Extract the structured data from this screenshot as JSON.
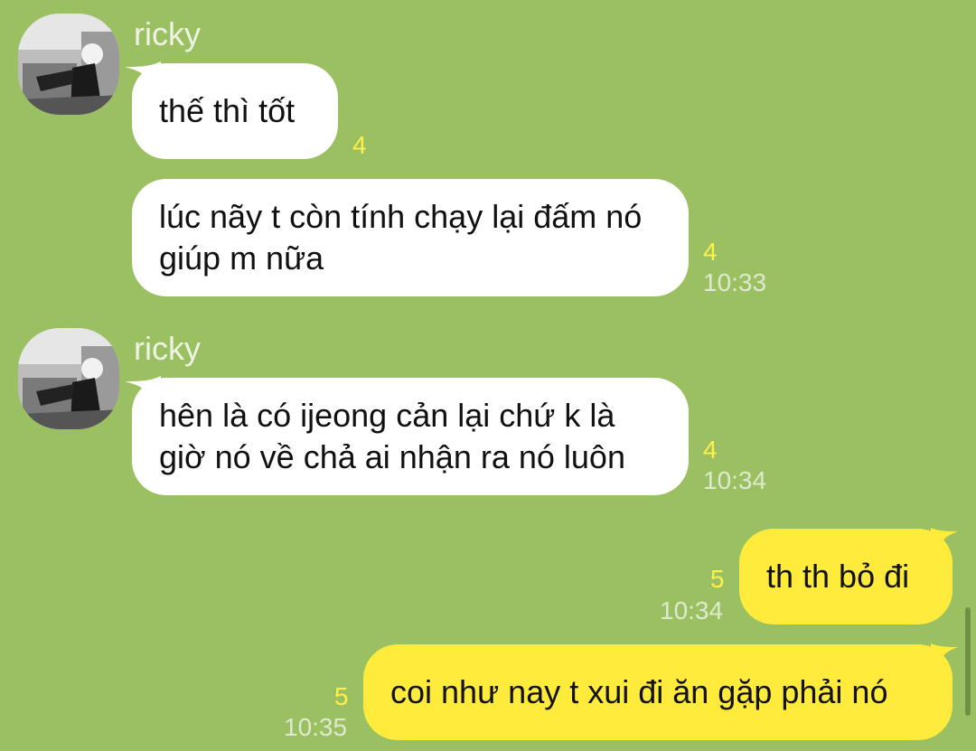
{
  "messages": [
    {
      "id": "m1",
      "direction": "incoming",
      "sender": "ricky",
      "text": "thế thì tốt",
      "read_count": "4",
      "time": ""
    },
    {
      "id": "m2",
      "direction": "incoming",
      "sender": "",
      "text": "lúc nãy t còn tính chạy lại đấm nó giúp m nữa",
      "read_count": "4",
      "time": "10:33"
    },
    {
      "id": "m3",
      "direction": "incoming",
      "sender": "ricky",
      "text": "hên là có ijeong cản lại chứ k là giờ nó về chả ai nhận ra nó luôn",
      "read_count": "4",
      "time": "10:34"
    },
    {
      "id": "m4",
      "direction": "outgoing",
      "sender": "",
      "text": "th th bỏ đi",
      "read_count": "5",
      "time": "10:34"
    },
    {
      "id": "m5",
      "direction": "outgoing",
      "sender": "",
      "text": "coi như nay t xui đi ăn gặp phải nó",
      "read_count": "5",
      "time": "10:35"
    }
  ],
  "colors": {
    "background": "#9bc061",
    "incoming_bubble": "#ffffff",
    "outgoing_bubble": "#ffeb3c",
    "read_count": "#fff04a",
    "timestamp": "#dfe9cf"
  },
  "icons": {
    "avatar": "profile-photo-grayscale"
  }
}
